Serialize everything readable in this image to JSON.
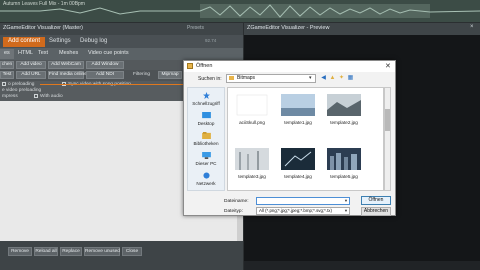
{
  "wave": {
    "title": "Autumn Leaves Full Mix - 1m 00Bpm"
  },
  "plugin": {
    "title": "ZGameEditor Visualizer (Master)",
    "presets_label": "Presets",
    "fps": "92.74",
    "tabs": [
      {
        "label": "Add content",
        "active": true
      },
      {
        "label": "Settings",
        "active": false
      },
      {
        "label": "Debug log",
        "active": false
      }
    ],
    "subtabs": [
      {
        "label": "es",
        "active": true
      },
      {
        "label": "HTML",
        "active": false
      },
      {
        "label": "Text",
        "active": false
      },
      {
        "label": "Meshes",
        "active": false
      },
      {
        "label": "Video cue points",
        "active": false
      }
    ],
    "row1_buttons": [
      "chen",
      "Add video",
      "Add WebCam",
      "Add Window"
    ],
    "row2_buttons": [
      "Test",
      "Add URL",
      "Find media online",
      "Add NDI"
    ],
    "filtering_label": "Filtering",
    "mipmap_label": "Mipmap",
    "options": [
      "o preloading",
      "Sync video with song position",
      "e video preloading",
      "mpress",
      "With audio"
    ],
    "bottom_buttons": [
      "Remove",
      "Reload all",
      "Replace",
      "Remove unused",
      "Close"
    ]
  },
  "preview": {
    "title": "ZGameEditor Visualizer - Preview",
    "close": "×"
  },
  "dialog": {
    "title": "Öffnen",
    "close": "✕",
    "look_in_label": "Suchen in:",
    "look_in_value": "Bitmaps",
    "places": [
      "Schnellzugriff",
      "Desktop",
      "Bibliotheken",
      "Dieser PC",
      "Netzwerk"
    ],
    "files": [
      {
        "name": "aciiSkull.png",
        "style": "white"
      },
      {
        "name": "template1.jpg",
        "style": "blue-sky"
      },
      {
        "name": "template2.jpg",
        "style": "landscape"
      },
      {
        "name": "template3.jpg",
        "style": "foggy"
      },
      {
        "name": "template4.jpg",
        "style": "dark-sparks"
      },
      {
        "name": "template5.jpg",
        "style": "city-night"
      }
    ],
    "filename_label": "Dateiname:",
    "filename_value": "",
    "filetype_label": "Dateityp:",
    "filetype_value": "All (*.png;*.jpg;*.jpeg;*.bmp;*.svg;*.tx)",
    "open_label": "Öffnen",
    "cancel_label": "Abbrechen"
  },
  "colors": {
    "accent": "#d16a1c",
    "arrow": "#e0781e"
  }
}
